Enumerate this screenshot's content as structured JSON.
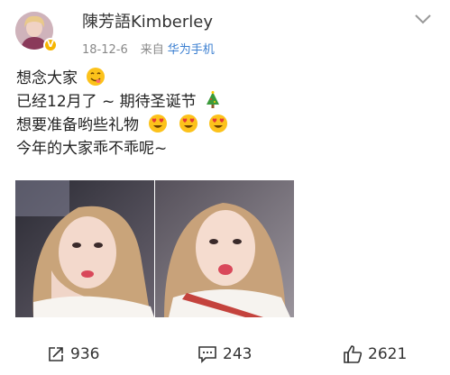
{
  "user": {
    "name": "陳芳語Kimberley",
    "verified_icon": "verified-v-icon"
  },
  "meta": {
    "date": "18-12-6",
    "from_label": "来自",
    "source": "华为手机"
  },
  "post": {
    "lines": [
      {
        "text": "想念大家",
        "emoji": "yum-face-icon"
      },
      {
        "text": "已经12月了 ~ 期待圣诞节",
        "emoji": "christmas-tree-icon"
      },
      {
        "text": "想要准备哟些礼物",
        "emoji": "heart-eyes-icon x3"
      },
      {
        "text": "今年的大家乖不乖呢~"
      }
    ]
  },
  "photos": [
    {
      "icon": "photo-selfie-icon"
    },
    {
      "icon": "photo-selfie-icon"
    }
  ],
  "actions": {
    "repost": {
      "icon": "repost-icon",
      "count": "936"
    },
    "comment": {
      "icon": "comment-icon",
      "count": "243"
    },
    "like": {
      "icon": "thumbs-up-icon",
      "count": "2621"
    }
  }
}
